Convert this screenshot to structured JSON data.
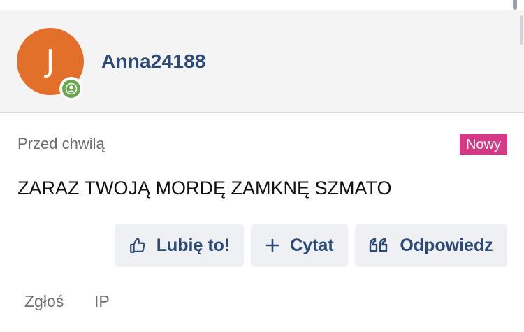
{
  "post": {
    "author": {
      "initial": "J",
      "username": "Anna24188",
      "avatar_color": "#e2702b",
      "status": "online",
      "status_color": "#6aa84f"
    },
    "timestamp": "Przed chwilą",
    "badge": "Nowy",
    "badge_color": "#d63a86",
    "message": "ZARAZ TWOJĄ MORDĘ ZAMKNĘ SZMATO"
  },
  "actions": {
    "like_label": "Lubię to!",
    "like_icon": "thumbs-up-icon",
    "quote_label": "Cytat",
    "quote_icon": "plus-icon",
    "reply_label": "Odpowiedz",
    "reply_icon": "quote-marks-icon"
  },
  "footer": {
    "report_label": "Zgłoś",
    "ip_label": "IP"
  },
  "colors": {
    "accent": "#2b4a78",
    "header_bg": "#f4f4f5",
    "button_bg": "#eef0f4"
  }
}
